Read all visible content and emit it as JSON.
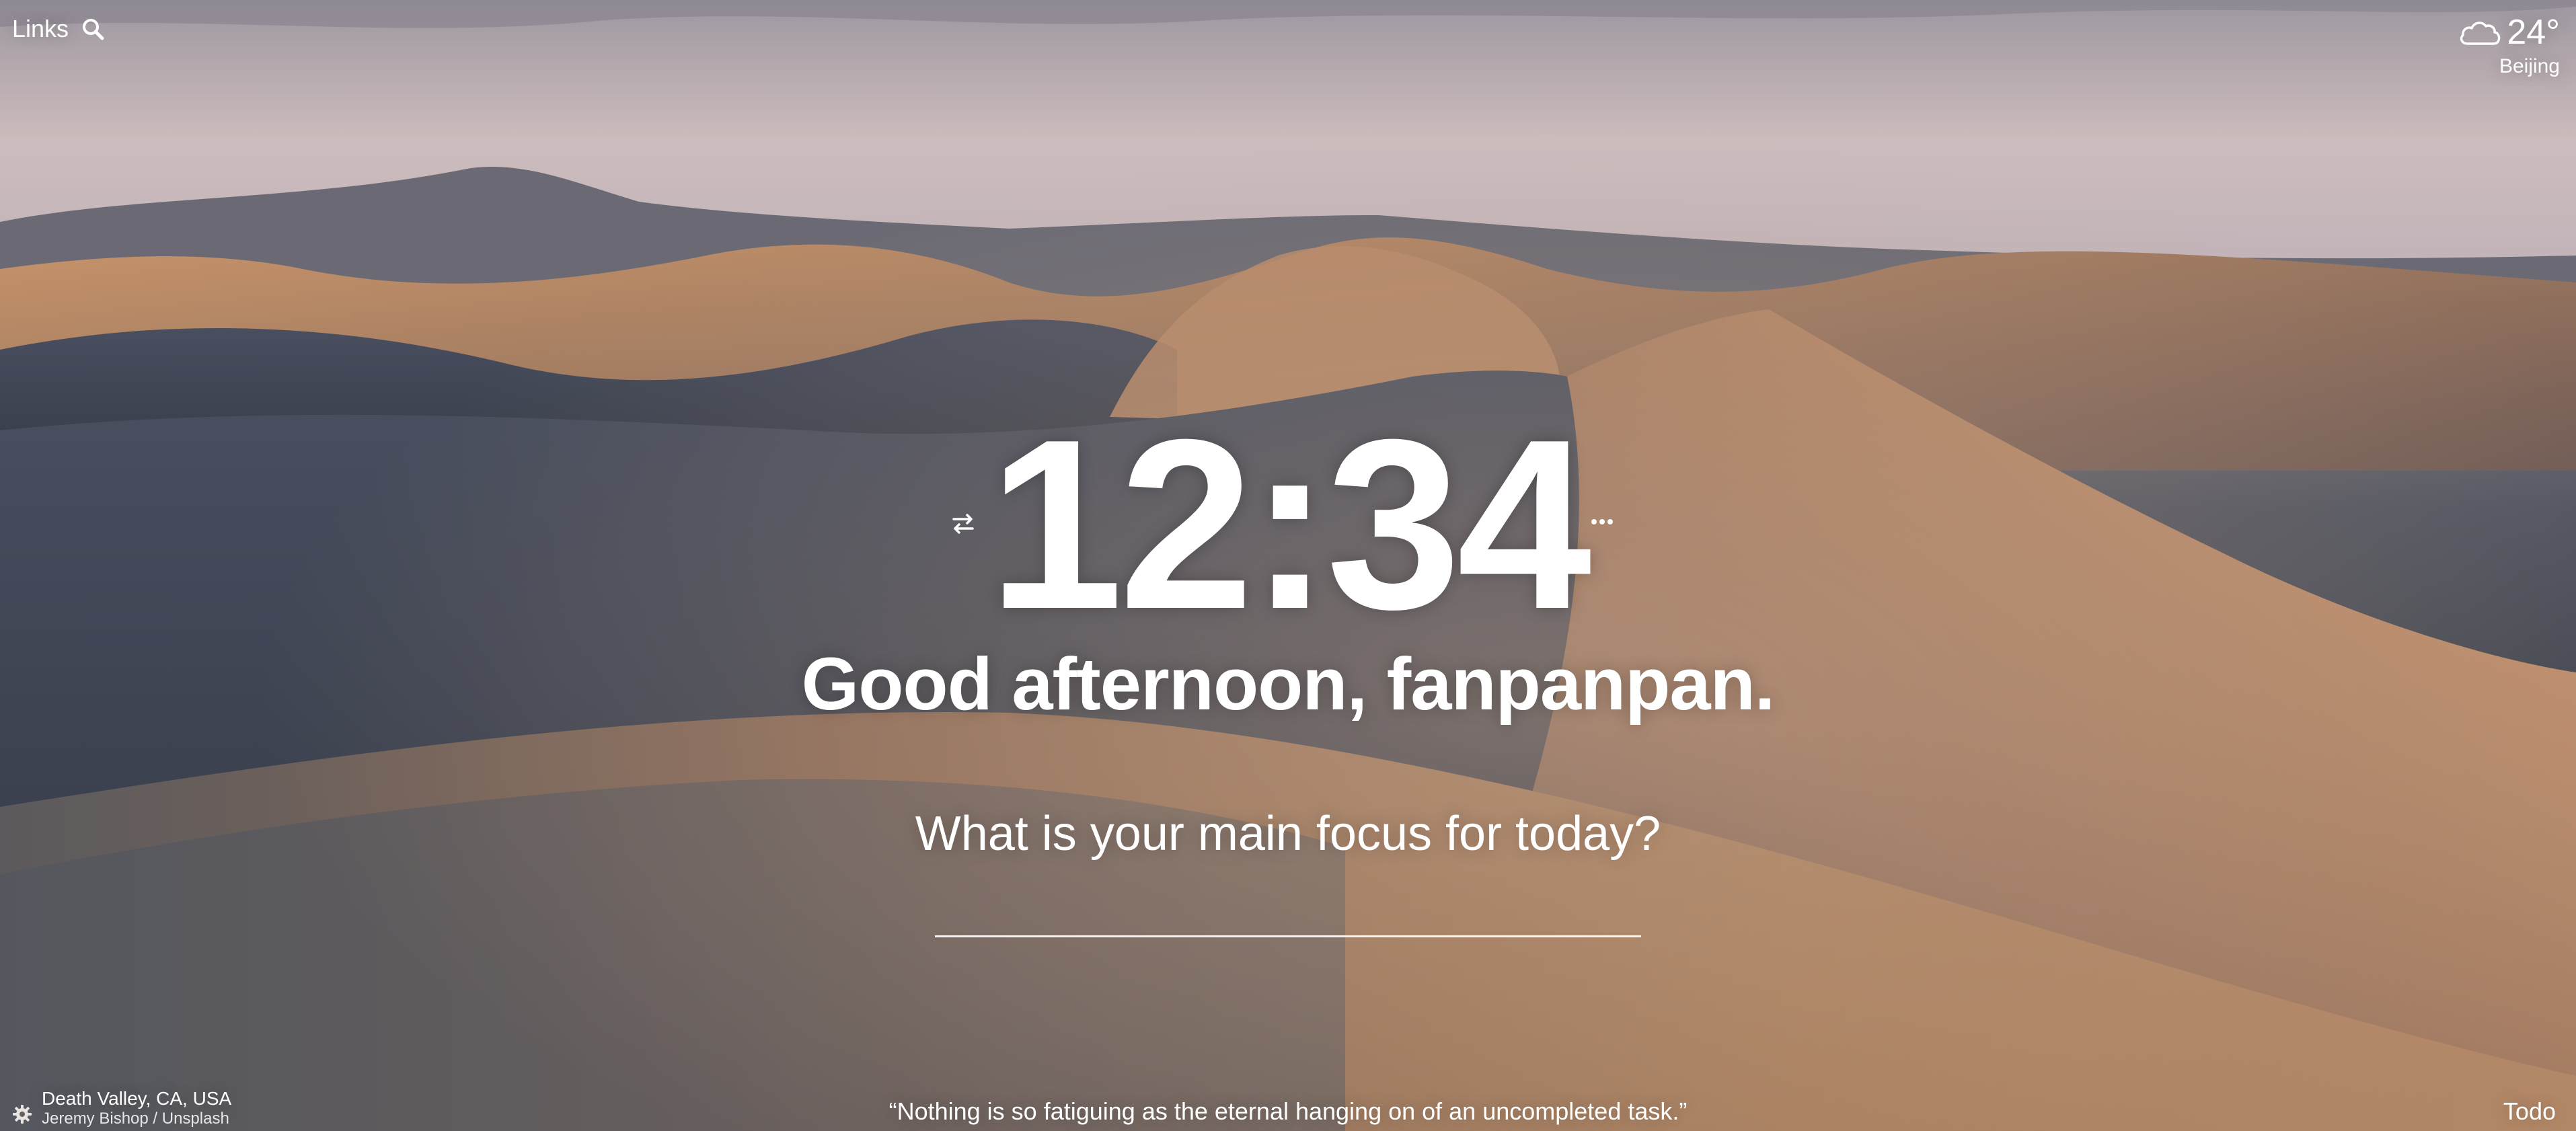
{
  "header": {
    "links_label": "Links"
  },
  "weather": {
    "temperature": "24°",
    "city": "Beijing",
    "icon": "cloud-icon"
  },
  "clock": {
    "time": "12:34"
  },
  "greeting": "Good afternoon, fanpanpan.",
  "focus": {
    "question": "What is your main focus for today?",
    "value": ""
  },
  "photo": {
    "location": "Death Valley, CA, USA",
    "credit": "Jeremy Bishop / Unsplash"
  },
  "quote": "“Nothing is so fatiguing as the eternal hanging on of an uncompleted task.”",
  "todo_label": "Todo",
  "colors": {
    "text": "#ffffff",
    "sky": "#c4b6b9",
    "dune_light": "#b88a66",
    "dune_shadow": "#3e4450"
  }
}
